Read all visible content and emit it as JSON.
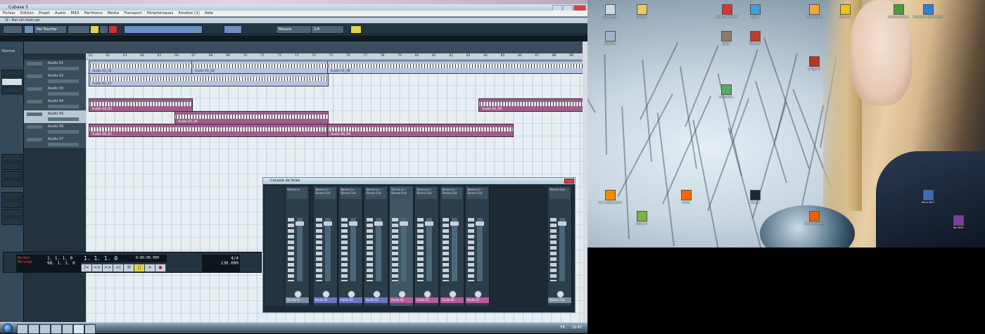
{
  "window": {
    "title": "Cubase 5",
    "project_title": "N - Nel vill chek.cpr",
    "left_toolbar_label": "Sans Perso"
  },
  "menu": [
    "Fichier",
    "Edition",
    "Projet",
    "Audio",
    "MIDI",
    "Partitions",
    "Media",
    "Transport",
    "Périphériques",
    "Fenêtre (1)",
    "Aide"
  ],
  "toolbar": {
    "mode": "Par Toucher",
    "grid": "Mesure",
    "quantize": "1/4"
  },
  "inspector": {
    "title": "Normal"
  },
  "ruler": [
    "61",
    "62",
    "63",
    "64",
    "65",
    "66",
    "67",
    "68",
    "69",
    "70",
    "71",
    "72",
    "73",
    "74",
    "75",
    "76",
    "77",
    "78",
    "79",
    "80",
    "81",
    "82",
    "83",
    "84",
    "85",
    "86",
    "87",
    "88",
    "89"
  ],
  "tracks": [
    {
      "name": "Audio 01"
    },
    {
      "name": "Audio 02"
    },
    {
      "name": "Audio 03"
    },
    {
      "name": "Audio 04"
    },
    {
      "name": "Audio 05"
    },
    {
      "name": "Audio 06"
    },
    {
      "name": "Audio 07"
    }
  ],
  "clips": [
    {
      "name": "Audio 01_01"
    },
    {
      "name": "Audio 01_04"
    },
    {
      "name": "Audio 01_09"
    },
    {
      "name": "Audio 02_11"
    },
    {
      "name": "Audio 04_02"
    },
    {
      "name": "Audio 04_18"
    },
    {
      "name": "Audio 05_06"
    },
    {
      "name": "Audio 06_03"
    },
    {
      "name": "Audio 06_08"
    }
  ],
  "transport": {
    "left": "1. 1. 1. 0",
    "right": "1. 1. 1. 0",
    "position": "1. 1. 1. 0",
    "time": "0:00:00.000",
    "tempo": "130.000",
    "signature": "4/4",
    "end": "98. 1. 1. 0",
    "marker1": "Normal",
    "marker2": "Mélange",
    "buttons": [
      "|<",
      "<<",
      ">>",
      ">|",
      "⟲",
      "◻",
      ">",
      "●"
    ]
  },
  "mixer": {
    "title": "Console de Voies",
    "channels": [
      {
        "name": "Stereo In",
        "routing": "Stereo In",
        "color": "#7a90a2"
      },
      {
        "name": "Audio 01",
        "routing": "Stereo In / Stereo Out",
        "color": "#6b75c9"
      },
      {
        "name": "Audio 02",
        "routing": "Stereo In / Stereo Out",
        "color": "#6b75c9"
      },
      {
        "name": "Audio 03",
        "routing": "Stereo In / Stereo Out",
        "color": "#6b75c9"
      },
      {
        "name": "Audio 04",
        "routing": "Stereo In / Stereo Out",
        "color": "#b45d9f"
      },
      {
        "name": "Audio 05",
        "routing": "Stereo In / Stereo Out",
        "color": "#b45d9f"
      },
      {
        "name": "Audio 06",
        "routing": "Stereo In / Stereo Out",
        "color": "#b45d9f"
      },
      {
        "name": "Audio 07",
        "routing": "Stereo In / Stereo Out",
        "color": "#b45d9f"
      },
      {
        "name": "Stereo Out",
        "routing": "Stereo Out",
        "color": "#7a90a2"
      }
    ]
  },
  "desktop_icons": [
    {
      "label": "Ordinateur",
      "color": "#cfd8e4"
    },
    {
      "label": "Dossier",
      "color": "#e8c96a"
    },
    {
      "label": "Nero StartSmart",
      "color": "#d33"
    },
    {
      "label": "Skype",
      "color": "#3aa0e0"
    },
    {
      "label": "FL Studio 9",
      "color": "#f2a73b"
    },
    {
      "label": "Winamp",
      "color": "#f5c400"
    },
    {
      "label": "Google Chrome",
      "color": "#4a9d3a"
    },
    {
      "label": "Windows Media Player",
      "color": "#2f7fd0"
    },
    {
      "label": "Corbeille",
      "color": "#9fb4c8"
    },
    {
      "label": "Gimp",
      "color": "#8b7b6a"
    },
    {
      "label": "Picasa 3",
      "color": "#c0392b"
    },
    {
      "label": "Cubase 5",
      "color": "#b32"
    },
    {
      "label": "Photofiltre",
      "color": "#5a6"
    },
    {
      "label": "VLC media player",
      "color": "#f38b00"
    },
    {
      "label": "µTorrent",
      "color": "#7cb342"
    },
    {
      "label": "Avast",
      "color": "#f60"
    },
    {
      "label": "Steam",
      "color": "#1b2838"
    },
    {
      "label": "Mozilla Firefox",
      "color": "#e66000"
    },
    {
      "label": "Paint.NET",
      "color": "#3d6db5"
    },
    {
      "label": "WinRAR",
      "color": "#7b3fa0"
    }
  ],
  "taskbar": {
    "clock": "19:45",
    "tray_lang": "FR"
  }
}
